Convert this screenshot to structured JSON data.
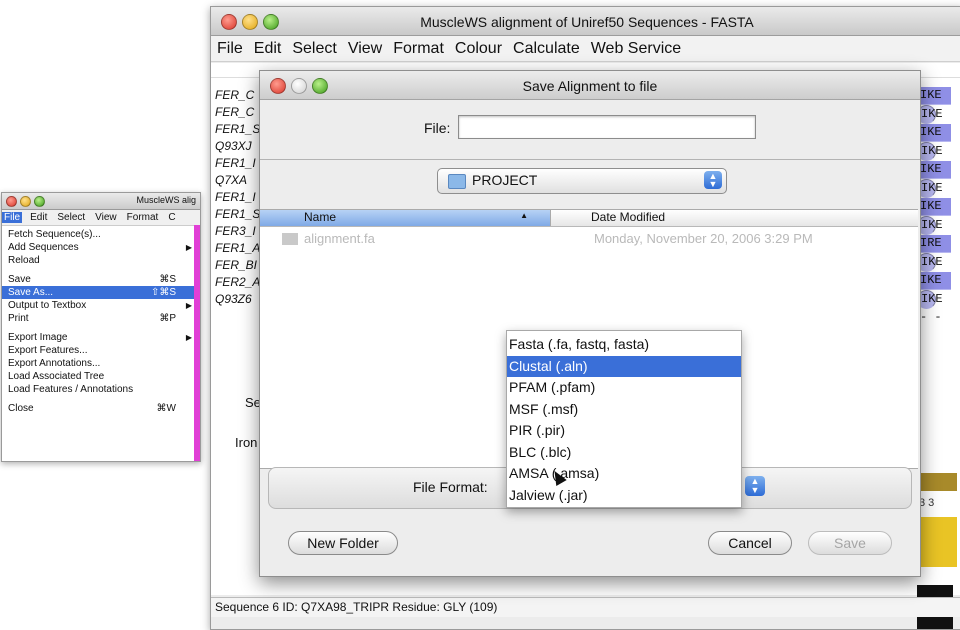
{
  "main_window": {
    "title": "MuscleWS alignment of Uniref50 Sequences - FASTA",
    "menus": [
      "File",
      "Edit",
      "Select",
      "View",
      "Format",
      "Colour",
      "Calculate",
      "Web Service"
    ],
    "sequence_ids": [
      "FER_C",
      "FER_C",
      "FER1_S",
      "Q93XJ",
      "FER1_I",
      "Q7XA",
      "FER1_I",
      "FER1_S",
      "FER3_I",
      "FER1_A",
      "FER_BI",
      "FER2_A",
      "Q93Z6"
    ],
    "right_residues": [
      "IKE",
      "IKE",
      "IKE",
      "IKE",
      "IKE",
      "IKE",
      "IKE",
      "IKE",
      "IRE",
      "IKE",
      "IKE",
      "IKE",
      "- -"
    ],
    "annotation_labels": [
      "Se",
      "Iron"
    ],
    "annotation_number": "3 3",
    "status": "Sequence 6 ID: Q7XA98_TRIPR  Residue: GLY (109)"
  },
  "file_menu_window": {
    "title": "MuscleWS alig",
    "menus": [
      "File",
      "Edit",
      "Select",
      "View",
      "Format",
      "C"
    ],
    "items": [
      {
        "label": "Fetch Sequence(s)...",
        "shortcut": "",
        "submenu": false
      },
      {
        "label": "Add Sequences",
        "shortcut": "",
        "submenu": true
      },
      {
        "label": "Reload",
        "shortcut": "",
        "submenu": false
      },
      {
        "label": "Save",
        "shortcut": "⌘S",
        "submenu": false
      },
      {
        "label": "Save As...",
        "shortcut": "⇧⌘S",
        "submenu": false
      },
      {
        "label": "Output to Textbox",
        "shortcut": "",
        "submenu": true
      },
      {
        "label": "Print",
        "shortcut": "⌘P",
        "submenu": false
      },
      {
        "label": "Export Image",
        "shortcut": "",
        "submenu": true
      },
      {
        "label": "Export Features...",
        "shortcut": "",
        "submenu": false
      },
      {
        "label": "Export Annotations...",
        "shortcut": "",
        "submenu": false
      },
      {
        "label": "Load Associated Tree",
        "shortcut": "",
        "submenu": false
      },
      {
        "label": "Load Features / Annotations",
        "shortcut": "",
        "submenu": false
      },
      {
        "label": "Close",
        "shortcut": "⌘W",
        "submenu": false
      }
    ]
  },
  "dialog": {
    "title": "Save Alignment to file",
    "file_label": "File:",
    "file_value": "",
    "folder": "PROJECT",
    "columns": {
      "name": "Name",
      "date": "Date Modified"
    },
    "files": [
      {
        "name": "alignment.fa",
        "date": "Monday, November 20, 2006 3:29 PM"
      }
    ],
    "format_label": "File Format:",
    "buttons": {
      "new_folder": "New Folder",
      "cancel": "Cancel",
      "save": "Save"
    }
  },
  "format_dropdown": {
    "options": [
      "Fasta (.fa, fastq, fasta)",
      "Clustal (.aln)",
      "PFAM (.pfam)",
      "MSF (.msf)",
      "PIR (.pir)",
      "BLC (.blc)",
      "AMSA (.amsa)",
      "Jalview (.jar)"
    ],
    "highlighted": "Clustal (.aln)"
  },
  "colors": {
    "selection": "#3a6fd8",
    "residue_blue": "#8f8fe6",
    "annotation_yellow": "#e9c425"
  }
}
